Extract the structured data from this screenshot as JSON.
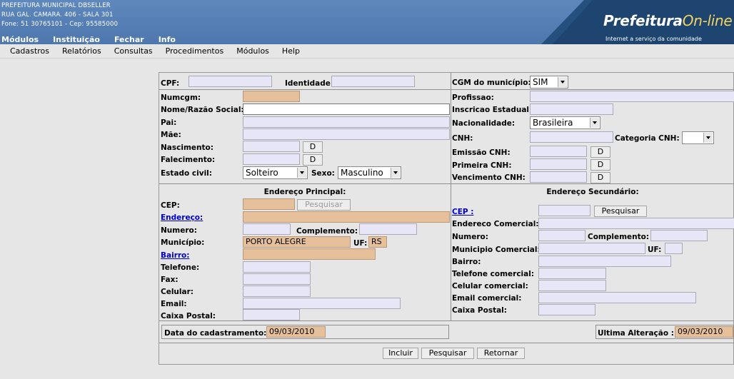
{
  "header": {
    "line1": "PREFEITURA MUNICIPAL DBSELLER",
    "line2": "RUA GAL. CAMARA. 406 - SALA 301",
    "line3": "Fone: 51 30765101  - Cep: 95585000",
    "menu": [
      "Módulos",
      "Instituição",
      "Fechar",
      "Info"
    ],
    "logo_main": "Prefeitura",
    "logo_accent": "On-line",
    "tagline": "Internet a serviço da comunidade"
  },
  "submenu": [
    "Cadastros",
    "Relatórios",
    "Consultas",
    "Procedimentos",
    "Módulos",
    "Help"
  ],
  "form": {
    "cpf_label": "CPF:",
    "cpf_value": "",
    "identidade_label": "Identidade:",
    "identidade_value": "",
    "cgm_label": "CGM do município:",
    "cgm_value": "SIM",
    "numcgm_label": "Numcgm:",
    "numcgm_value": "",
    "nome_label": "Nome/Razão Social:",
    "nome_value": "",
    "pai_label": "Pai:",
    "mae_label": "Mãe:",
    "nascimento_label": "Nascimento:",
    "falecimento_label": "Falecimento:",
    "date_btn": "D",
    "estado_civil_label": "Estado civil:",
    "estado_civil_value": "Solteiro",
    "sexo_label": "Sexo:",
    "sexo_value": "Masculino",
    "profissao_label": "Profissao:",
    "inscricao_label": "Inscricao Estadual:",
    "nacionalidade_label": "Nacionalidade:",
    "nacionalidade_value": "Brasileira",
    "cnh_label": "CNH:",
    "categoria_cnh_label": "Categoria CNH:",
    "categoria_cnh_value": "",
    "emissao_cnh_label": "Emissão CNH:",
    "primeira_cnh_label": "Primeira CNH:",
    "vencimento_cnh_label": "Vencimento CNH:"
  },
  "endereco_principal": {
    "title": "Endereço Principal:",
    "cep_label": "CEP:",
    "pesquisar_btn": "Pesquisar",
    "endereco_label": "Endereço:",
    "numero_label": "Numero:",
    "complemento_label": "Complemento:",
    "municipio_label": "Município:",
    "municipio_value": "PORTO ALEGRE",
    "uf_label": "UF:",
    "uf_value": "RS",
    "bairro_label": "Bairro:",
    "telefone_label": "Telefone:",
    "fax_label": "Fax:",
    "celular_label": "Celular:",
    "email_label": "Email:",
    "caixa_postal_label": "Caixa Postal:"
  },
  "endereco_secundario": {
    "title": "Endereço Secundário:",
    "cep_label": "CEP :",
    "pesquisar_btn": "Pesquisar",
    "endereco_label": "Endereco Comercial:",
    "numero_label": "Numero:",
    "complemento_label": "Complemento:",
    "municipio_label": "Municipio Comercial:",
    "uf_label": "UF:",
    "bairro_label": "Bairro:",
    "telefone_label": "Telefone comercial:",
    "celular_label": "Celular comercial:",
    "email_label": "Email comercial:",
    "caixa_postal_label": "Caixa Postal:"
  },
  "footer": {
    "data_cadastro_label": "Data do cadastramento:",
    "data_cadastro_value": "09/03/2010",
    "ultima_alteracao_label": "Ultima Alteração :",
    "ultima_alteracao_value": "09/03/2010",
    "incluir_btn": "Incluir",
    "pesquisar_btn": "Pesquisar",
    "retornar_btn": "Retornar"
  },
  "colors": {
    "header_bg": "#5f88bd",
    "header_dark": "#25507e",
    "logo_accent": "#f4d35e",
    "required_field": "#e5c09a",
    "input_bg": "#e6e6f6",
    "page_bg": "#e6e6e6",
    "link": "#0000cc"
  }
}
